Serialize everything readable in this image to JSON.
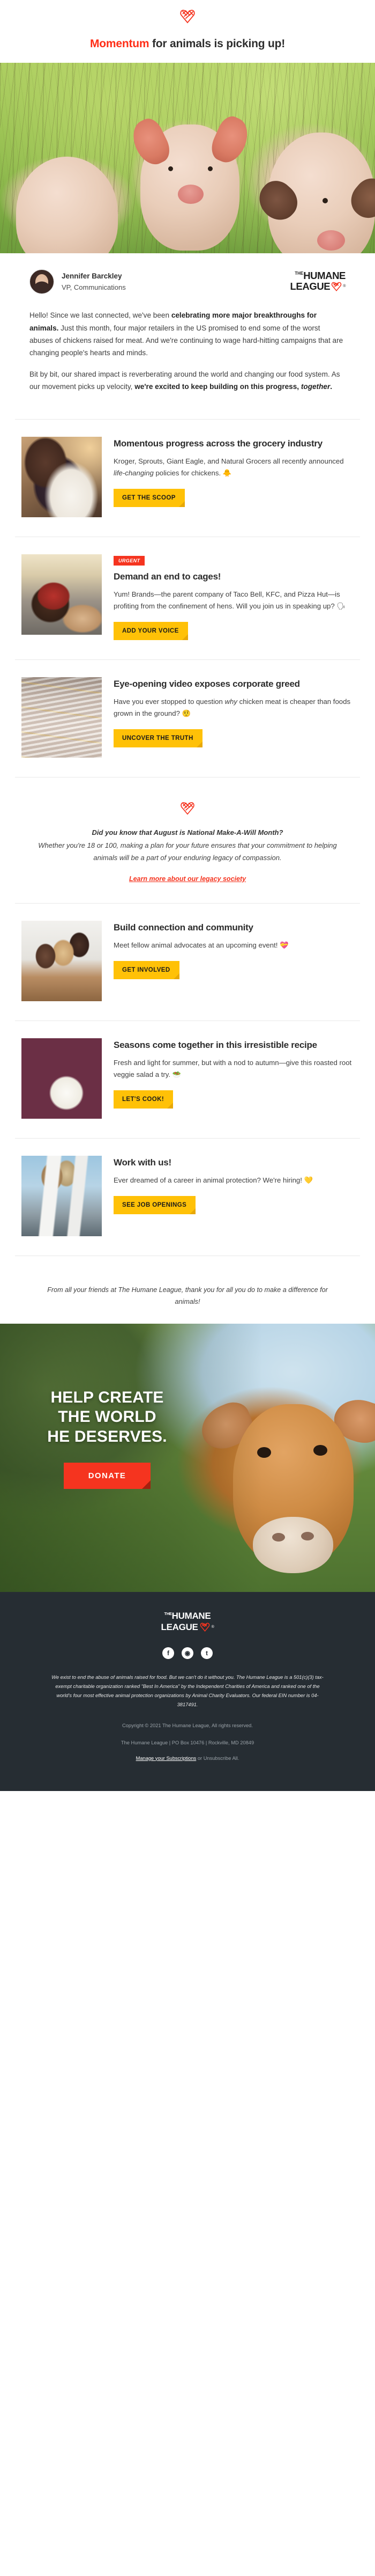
{
  "header": {
    "logo_icon": "humane-league-heart-icon",
    "headline_accent": "Momentum",
    "headline_rest": " for animals is picking up!"
  },
  "hero": {
    "alt": "three pigs standing in a green field"
  },
  "author": {
    "avatar_icon": "author-avatar",
    "name": "Jennifer Barckley",
    "role": "VP, Communications"
  },
  "brand": {
    "the": "THE",
    "line1": "HUMANE",
    "line2": "LEAGUE",
    "registered": "®",
    "heart_icon": "humane-league-heart-icon"
  },
  "intro": {
    "p1_a": "Hello! Since we last connected, we've been ",
    "p1_b": "celebrating more major breakthroughs for animals.",
    "p1_c": " Just this month, four major retailers in the US promised to end some of the worst abuses of chickens raised for meat. And we're continuing to wage hard-hitting campaigns that are changing people's hearts and minds.",
    "p2_a": "Bit by bit, our shared impact is reverberating around the world and changing our food system. As our movement picks up velocity, ",
    "p2_b": "we're excited to keep building on this progress, ",
    "p2_c": "together",
    "p2_d": "."
  },
  "stories": [
    {
      "thumb_icon": "chicken-rescue-photo",
      "badge": "",
      "title": "Momentous progress across the grocery industry",
      "text_a": "Kroger, Sprouts, Giant Eagle, and Natural Grocers all recently announced ",
      "text_i": "life-changing",
      "text_b": " policies for chickens. 🐥",
      "button": "GET THE SCOOP"
    },
    {
      "thumb_icon": "caged-hen-photo",
      "badge": "URGENT",
      "title": "Demand an end to cages!",
      "text_a": "Yum! Brands—the parent company of Taco Bell, KFC, and Pizza Hut—is profiting from the confinement of hens. Will you join us in speaking up? 🗣",
      "text_i": "",
      "text_b": "",
      "button": "ADD YOUR VOICE"
    },
    {
      "thumb_icon": "broiler-shed-photo",
      "badge": "",
      "title": "Eye-opening video exposes corporate greed",
      "text_a": "Have you ever stopped to question ",
      "text_i": "why",
      "text_b": " chicken meat is cheaper than foods grown in the ground? 🤨",
      "button": "UNCOVER THE TRUTH"
    }
  ],
  "legacy": {
    "heart_icon": "humane-league-heart-icon",
    "lead": "Did you know that August is National Make-A-Will Month?",
    "body": "Whether you're 18 or 100, making a plan for your future ensures that your commitment to helping animals will be a part of your enduring legacy of compassion.",
    "link": "Learn more about our legacy society"
  },
  "stories2": [
    {
      "thumb_icon": "volunteers-table-photo",
      "title": "Build connection and community",
      "text": "Meet fellow animal advocates at an upcoming event! 💝",
      "button": "GET INVOLVED"
    },
    {
      "thumb_icon": "roasted-veggie-salad-photo",
      "title": "Seasons come together in this irresistible recipe",
      "text": "Fresh and light for summer, but with a nod to autumn—give this roasted root veggie salad a try. 🥗",
      "button": "LET'S COOK!"
    },
    {
      "thumb_icon": "protest-signs-photo",
      "title": "Work with us!",
      "text": "Ever dreamed of a career in animal protection? We're hiring! 💛",
      "button": "SEE JOB OPENINGS"
    }
  ],
  "thanks": "From all your friends at The Humane League, thank you for all you do to make a difference for animals!",
  "donate": {
    "line1": "HELP CREATE",
    "line2": "THE WORLD",
    "line3": "HE DESERVES.",
    "button": "DONATE",
    "image_alt": "brown calf in a green field"
  },
  "footer": {
    "socials": [
      {
        "icon": "facebook-icon",
        "glyph": "f"
      },
      {
        "icon": "instagram-icon",
        "glyph": "◉"
      },
      {
        "icon": "twitter-icon",
        "glyph": "t"
      }
    ],
    "legal": "We exist to end the abuse of animals raised for food. But we can't do it without you. The Humane League is a 501(c)(3) tax-exempt charitable organization ranked \"Best In America\" by the Independent Charities of America and ranked one of the world's four most effective animal protection organizations by Animal Charity Evaluators. Our federal EIN number is 04-3817491.",
    "copyright": "Copyright © 2021 The Humane League, All rights reserved.",
    "address": "The Humane League | PO Box 10476 | Rockville, MD 20849",
    "manage_link": "Manage your Subscriptions",
    "unsub_rest": " or Unsubscribe All."
  },
  "colors": {
    "accent_red": "#f5341f",
    "button_yellow": "#ffc107",
    "footer_bg": "#262d33",
    "text": "#3d3d3d"
  }
}
